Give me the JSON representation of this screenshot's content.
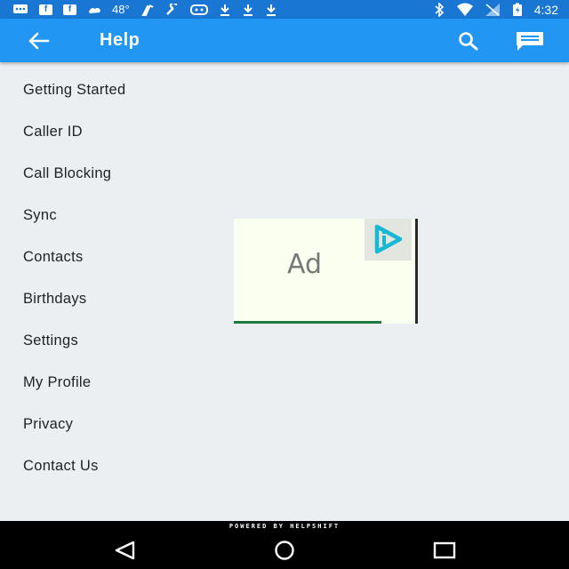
{
  "status_bar": {
    "temperature": "48°",
    "time": "4:32",
    "icons_left": [
      "message-icon",
      "facebook-icon",
      "facebook-icon",
      "weather-icon",
      "temperature-text",
      "cleaner-icon",
      "wrench-icon",
      "gamepad-icon",
      "download-icon",
      "download-icon",
      "download-icon"
    ],
    "icons_right": [
      "bluetooth-icon",
      "wifi-icon",
      "signal-icon",
      "battery-icon"
    ],
    "facebook_glyph": "f"
  },
  "app_bar": {
    "title": "Help"
  },
  "menu": [
    {
      "label": "Getting Started"
    },
    {
      "label": "Caller ID"
    },
    {
      "label": "Call Blocking"
    },
    {
      "label": "Sync"
    },
    {
      "label": "Contacts"
    },
    {
      "label": "Birthdays"
    },
    {
      "label": "Settings"
    },
    {
      "label": "My Profile"
    },
    {
      "label": "Privacy"
    },
    {
      "label": "Contact Us"
    }
  ],
  "ad": {
    "label": "Ad"
  },
  "footer": {
    "powered_by": "POWERED BY HELPSHIFT"
  },
  "colors": {
    "status_bar": "#1976d2",
    "app_bar": "#2196f3",
    "background": "#ebeff2",
    "ad_logo": "#17b7d6"
  }
}
